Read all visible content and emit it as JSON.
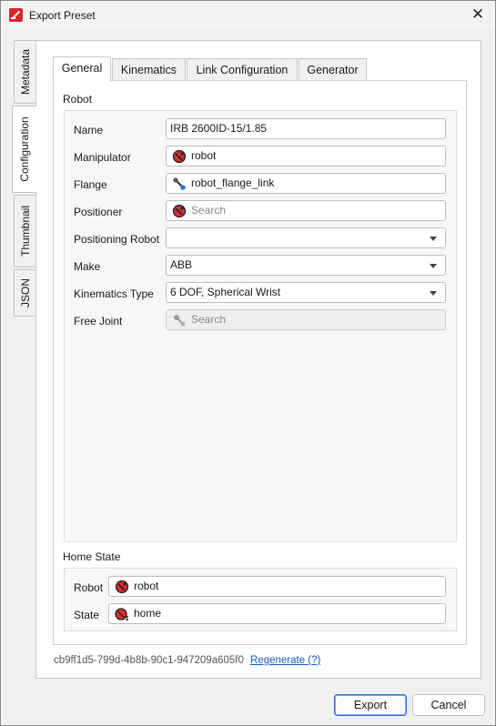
{
  "window": {
    "title": "Export Preset",
    "close_glyph": "✕"
  },
  "side_tabs": [
    {
      "label": "Metadata"
    },
    {
      "label": "Configuration"
    },
    {
      "label": "Thumbnail"
    },
    {
      "label": "JSON"
    }
  ],
  "top_tabs": [
    {
      "label": "General"
    },
    {
      "label": "Kinematics"
    },
    {
      "label": "Link Configuration"
    },
    {
      "label": "Generator"
    }
  ],
  "robot_section": {
    "title": "Robot",
    "name": {
      "label": "Name",
      "value": "IRB 2600ID-15/1.85"
    },
    "manipulator": {
      "label": "Manipulator",
      "value": "robot",
      "icon": "robot-icon"
    },
    "flange": {
      "label": "Flange",
      "value": "robot_flange_link",
      "icon": "link-icon"
    },
    "positioner": {
      "label": "Positioner",
      "placeholder": "Search",
      "icon": "robot-icon"
    },
    "positioning_robot": {
      "label": "Positioning Robot",
      "value": ""
    },
    "make": {
      "label": "Make",
      "value": "ABB"
    },
    "kinematics_type": {
      "label": "Kinematics Type",
      "value": "6 DOF, Spherical Wrist"
    },
    "free_joint": {
      "label": "Free Joint",
      "placeholder": "Search",
      "icon": "joint-icon"
    }
  },
  "home_state": {
    "title": "Home State",
    "robot": {
      "label": "Robot",
      "value": "robot",
      "icon": "robot-icon"
    },
    "state": {
      "label": "State",
      "value": "home",
      "icon": "robot-state-icon"
    }
  },
  "footer": {
    "uuid": "cb9ff1d5-799d-4b8b-90c1-947209a605f0",
    "regenerate": "Regenerate (?)",
    "export_label": "Export",
    "cancel_label": "Cancel"
  },
  "colors": {
    "accent": "#2a6fd4",
    "brand": "#d6262d",
    "link": "#1a57c6"
  }
}
